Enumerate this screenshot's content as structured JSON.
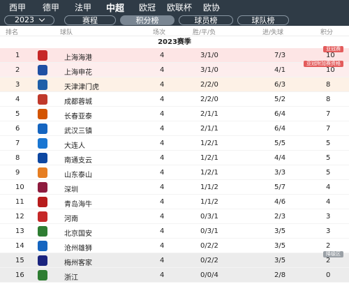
{
  "league_tabs": [
    "西甲",
    "德甲",
    "法甲",
    "中超",
    "欧冠",
    "欧联杯",
    "欧协"
  ],
  "active_league": "中超",
  "sub_bar": {
    "season": "2023",
    "tabs": [
      "赛程",
      "积分榜",
      "球员榜",
      "球队榜"
    ],
    "active_tab": "积分榜"
  },
  "columns": {
    "rank": "排名",
    "team": "球队",
    "played": "场次",
    "wdl": "胜/平/负",
    "goals": "进/失球",
    "points": "积分"
  },
  "season_title": "2023赛季",
  "badges": {
    "afc_champions": "亚冠赛",
    "afc_playoff": "亚冠附加赛资格",
    "relegation": "降级区"
  },
  "rows": [
    {
      "rank": "1",
      "team": "上海海港",
      "played": "4",
      "wdl": "3/1/0",
      "goals": "7/3",
      "points": "10",
      "logo_color": "#c62828"
    },
    {
      "rank": "2",
      "team": "上海申花",
      "played": "4",
      "wdl": "3/1/0",
      "goals": "4/1",
      "points": "10",
      "logo_color": "#1e4fa3"
    },
    {
      "rank": "3",
      "team": "天津津门虎",
      "played": "4",
      "wdl": "2/2/0",
      "goals": "6/3",
      "points": "8",
      "logo_color": "#1f5fa8"
    },
    {
      "rank": "4",
      "team": "成都蓉城",
      "played": "4",
      "wdl": "2/2/0",
      "goals": "5/2",
      "points": "8",
      "logo_color": "#c0392b"
    },
    {
      "rank": "5",
      "team": "长春亚泰",
      "played": "4",
      "wdl": "2/1/1",
      "goals": "6/4",
      "points": "7",
      "logo_color": "#d35400"
    },
    {
      "rank": "6",
      "team": "武汉三镇",
      "played": "4",
      "wdl": "2/1/1",
      "goals": "6/4",
      "points": "7",
      "logo_color": "#1565c0"
    },
    {
      "rank": "7",
      "team": "大连人",
      "played": "4",
      "wdl": "1/2/1",
      "goals": "5/5",
      "points": "5",
      "logo_color": "#1976d2"
    },
    {
      "rank": "8",
      "team": "南通支云",
      "played": "4",
      "wdl": "1/2/1",
      "goals": "4/4",
      "points": "5",
      "logo_color": "#0d47a1"
    },
    {
      "rank": "9",
      "team": "山东泰山",
      "played": "4",
      "wdl": "1/2/1",
      "goals": "3/3",
      "points": "5",
      "logo_color": "#e67e22"
    },
    {
      "rank": "10",
      "team": "深圳",
      "played": "4",
      "wdl": "1/1/2",
      "goals": "5/7",
      "points": "4",
      "logo_color": "#8e1b3e"
    },
    {
      "rank": "11",
      "team": "青岛海牛",
      "played": "4",
      "wdl": "1/1/2",
      "goals": "4/6",
      "points": "4",
      "logo_color": "#b71c1c"
    },
    {
      "rank": "12",
      "team": "河南",
      "played": "4",
      "wdl": "0/3/1",
      "goals": "2/3",
      "points": "3",
      "logo_color": "#c62828"
    },
    {
      "rank": "13",
      "team": "北京国安",
      "played": "4",
      "wdl": "0/3/1",
      "goals": "3/5",
      "points": "3",
      "logo_color": "#2e7d32"
    },
    {
      "rank": "14",
      "team": "沧州雄狮",
      "played": "4",
      "wdl": "0/2/2",
      "goals": "3/5",
      "points": "2",
      "logo_color": "#1565c0"
    },
    {
      "rank": "15",
      "team": "梅州客家",
      "played": "4",
      "wdl": "0/2/2",
      "goals": "3/5",
      "points": "2",
      "logo_color": "#1a237e"
    },
    {
      "rank": "16",
      "team": "浙江",
      "played": "4",
      "wdl": "0/0/4",
      "goals": "2/8",
      "points": "0",
      "logo_color": "#2e7d32"
    }
  ]
}
